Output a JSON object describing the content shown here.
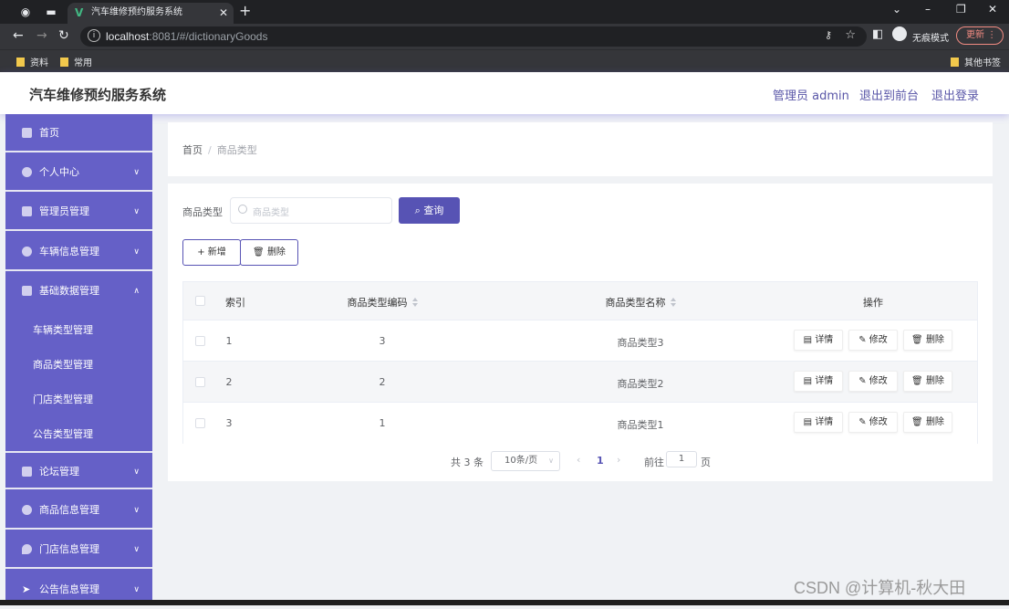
{
  "browser": {
    "tab_title": "汽车维修预约服务系统",
    "tab_logo": "V",
    "close_glyph": "✕",
    "newtab_glyph": "+",
    "url_host": "localhost",
    "url_rest": ":8081/#/dictionaryGoods",
    "incognito_label": "无痕模式",
    "update_label": "更新",
    "bookmarks": [
      "资料",
      "常用"
    ],
    "other_bookmarks": "其他书签"
  },
  "header": {
    "title": "汽车维修预约服务系统",
    "admin_label": "管理员 admin",
    "to_front": "退出到前台",
    "logout": "退出登录"
  },
  "sidebar": {
    "items": [
      {
        "label": "首页",
        "icon": "home-icon"
      },
      {
        "label": "个人中心",
        "icon": "user-icon"
      },
      {
        "label": "管理员管理",
        "icon": "monitor-icon"
      },
      {
        "label": "车辆信息管理",
        "icon": "car-icon"
      },
      {
        "label": "基础数据管理",
        "icon": "folder-icon"
      },
      {
        "label": "论坛管理",
        "icon": "grid-icon"
      },
      {
        "label": "商品信息管理",
        "icon": "goods-icon"
      },
      {
        "label": "门店信息管理",
        "icon": "location-icon"
      },
      {
        "label": "公告信息管理",
        "icon": "send-icon"
      }
    ],
    "subitems": [
      "车辆类型管理",
      "商品类型管理",
      "门店类型管理",
      "公告类型管理"
    ]
  },
  "breadcrumb": {
    "home": "首页",
    "sep": "/",
    "current": "商品类型"
  },
  "search": {
    "label": "商品类型",
    "placeholder": "商品类型",
    "button": "查询"
  },
  "actions": {
    "add": "+ 新增",
    "delete": "删除"
  },
  "table": {
    "headers": {
      "index": "索引",
      "code": "商品类型编码",
      "name": "商品类型名称",
      "ops": "操作"
    },
    "rows": [
      {
        "index": "1",
        "code": "3",
        "name": "商品类型3"
      },
      {
        "index": "2",
        "code": "2",
        "name": "商品类型2"
      },
      {
        "index": "3",
        "code": "1",
        "name": "商品类型1"
      }
    ],
    "op_labels": {
      "detail": "详情",
      "edit": "修改",
      "delete": "删除"
    }
  },
  "pagination": {
    "total": "共 3 条",
    "page_size": "10条/页",
    "current_page": "1",
    "goto_label": "前往",
    "goto_value": "1",
    "page_suffix": "页"
  },
  "watermark": "CSDN @计算机-秋大田",
  "colors": {
    "sidebar": "#6560c7",
    "primary": "#5753b4",
    "header_link": "#5a57a8"
  }
}
